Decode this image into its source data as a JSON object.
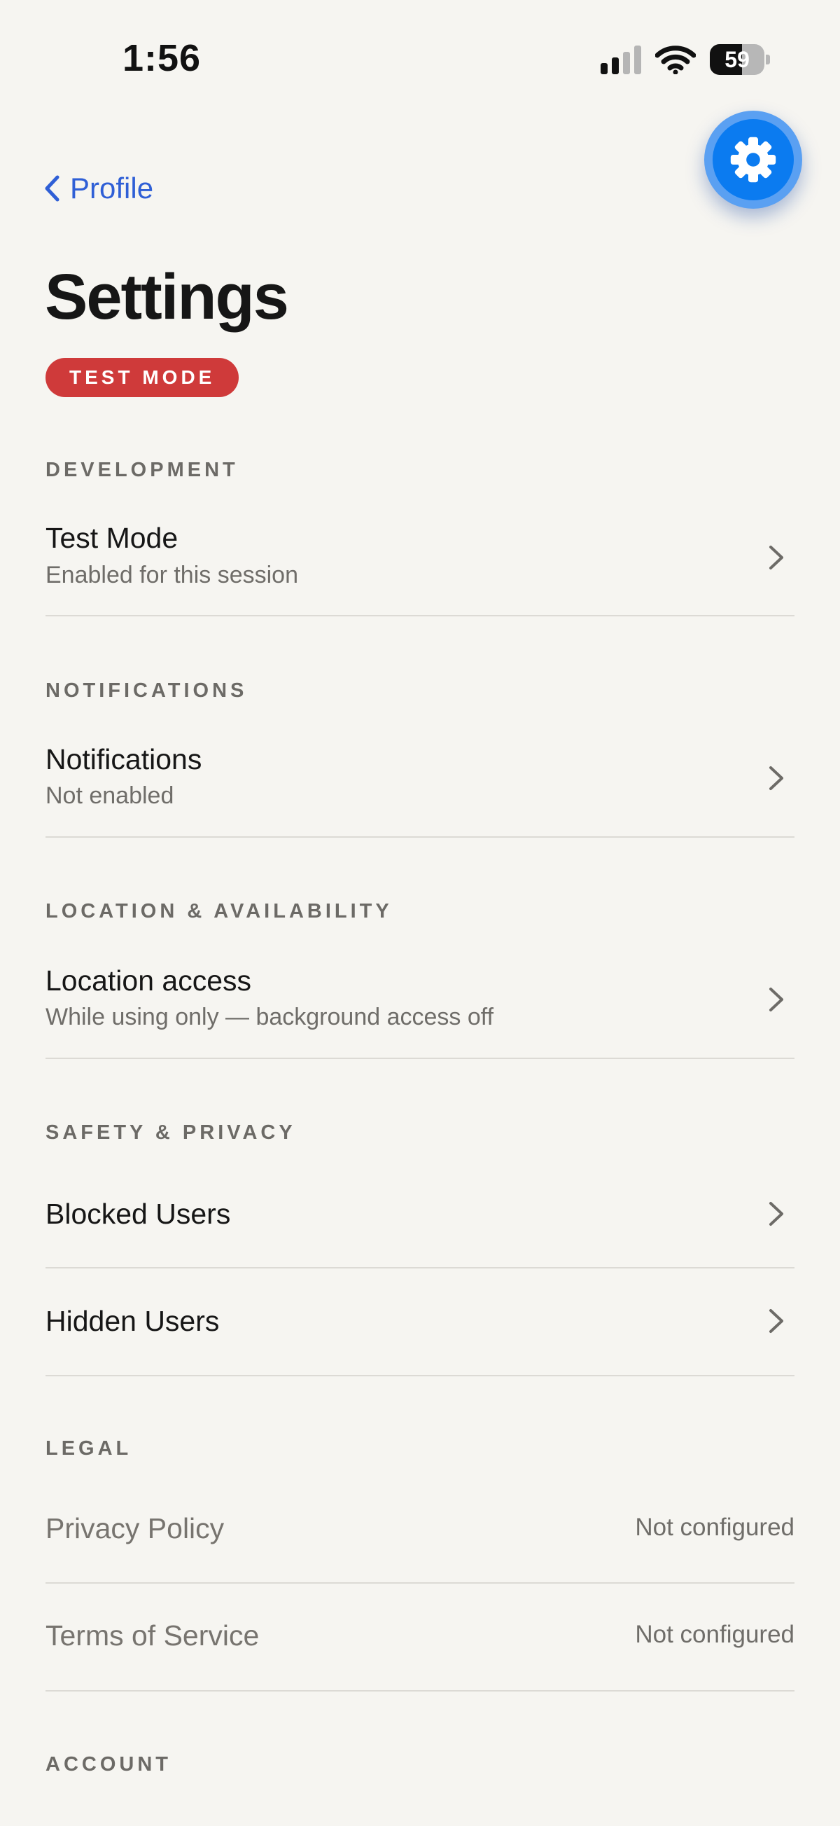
{
  "status_bar": {
    "time": "1:56",
    "battery_percent": 59,
    "battery_label": "59",
    "signal_bars": 2,
    "signal_icon": "cellular-signal-icon",
    "wifi_icon": "wifi-icon"
  },
  "nav": {
    "back_label": "Profile",
    "back_icon": "chevron-left-icon",
    "settings_icon": "gear-icon"
  },
  "page": {
    "title": "Settings",
    "mode_badge": "TEST MODE"
  },
  "colors": {
    "accent": "#2f5fd6",
    "fab": "#0b7bf0",
    "badge": "#cf3a3a",
    "background": "#f6f5f1"
  },
  "sections": {
    "development": {
      "header": "DEVELOPMENT",
      "test_mode": {
        "title": "Test Mode",
        "subtitle": "Enabled for this session"
      }
    },
    "notifications": {
      "header": "NOTIFICATIONS",
      "notifications": {
        "title": "Notifications",
        "subtitle": "Not enabled"
      }
    },
    "location": {
      "header": "LOCATION & AVAILABILITY",
      "location_access": {
        "title": "Location access",
        "subtitle": "While using only — background access off"
      }
    },
    "safety": {
      "header": "SAFETY & PRIVACY",
      "blocked_users": {
        "title": "Blocked Users"
      },
      "hidden_users": {
        "title": "Hidden Users"
      }
    },
    "legal": {
      "header": "LEGAL",
      "privacy_policy": {
        "title": "Privacy Policy",
        "value": "Not configured"
      },
      "terms_of_service": {
        "title": "Terms of Service",
        "value": "Not configured"
      }
    },
    "account": {
      "header": "ACCOUNT"
    }
  }
}
